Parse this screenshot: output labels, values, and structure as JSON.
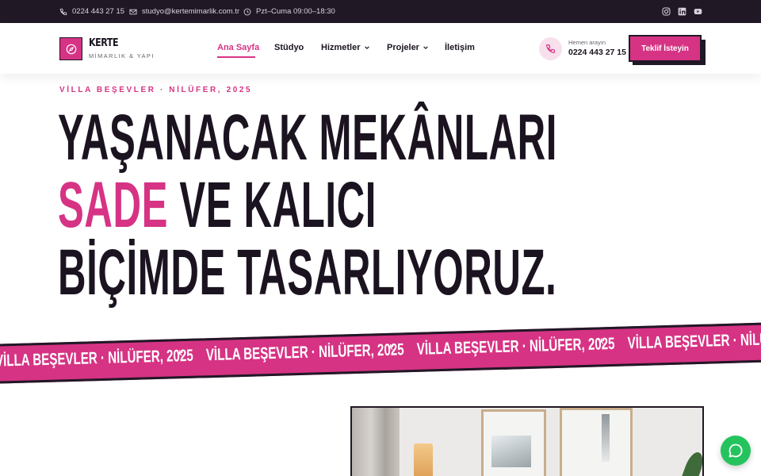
{
  "topbar": {
    "phone": "0224 443 27 15",
    "email": "studyo@kertemimarlik.com.tr",
    "hours": "Pzt–Cuma 09:00–18:30",
    "icons": [
      "phone-icon",
      "mail-icon",
      "clock-icon",
      "instagram-icon",
      "linkedin-icon",
      "youtube-icon"
    ]
  },
  "brand": {
    "name": "KERTE",
    "tagline": "MİMARLIK & YAPI",
    "icon": "compass-icon"
  },
  "nav": {
    "items": [
      {
        "label": "Ana Sayfa",
        "active": true
      },
      {
        "label": "Stüdyo"
      },
      {
        "label": "Hizmetler",
        "dropdown": true
      },
      {
        "label": "Projeler",
        "dropdown": true
      },
      {
        "label": "İletişim"
      }
    ]
  },
  "contact": {
    "label": "Hemen arayın",
    "phone": "0224 443 27 15"
  },
  "cta": {
    "label": "Teklif İsteyin"
  },
  "hero": {
    "eyebrow": "VİLLA BEŞEVLER · NİLÜFER, 2025",
    "line1": "YAŞANACAK MEKÂNLARI",
    "line2_accent": "SADE",
    "line2_rest": " VE KALICI",
    "line3": "BİÇİMDE TASARLIYORUZ."
  },
  "ribbon": {
    "text": "VİLLA BEŞEVLER · NİLÜFER, 2025",
    "separator": "*"
  },
  "colors": {
    "accent": "#d63384",
    "dark": "#211826",
    "whatsapp": "#25c35e"
  }
}
